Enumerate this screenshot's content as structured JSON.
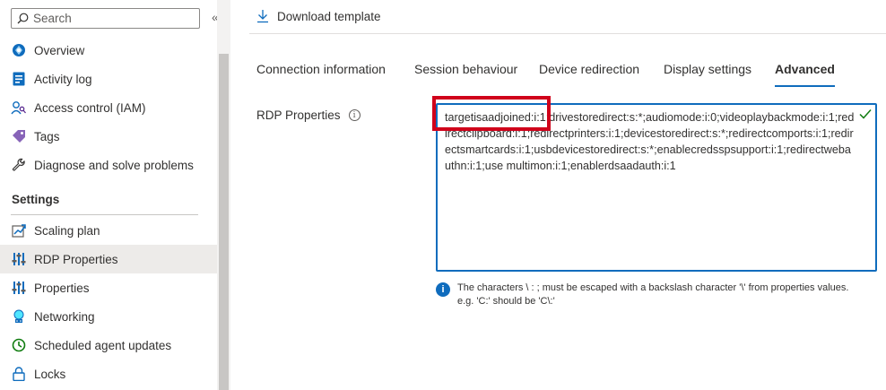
{
  "sidebar": {
    "search_placeholder": "Search",
    "collapse_glyph": "«",
    "items": [
      {
        "label": "Overview",
        "icon": "overview-icon"
      },
      {
        "label": "Activity log",
        "icon": "activity-log-icon"
      },
      {
        "label": "Access control (IAM)",
        "icon": "access-control-icon"
      },
      {
        "label": "Tags",
        "icon": "tag-icon"
      },
      {
        "label": "Diagnose and solve problems",
        "icon": "wrench-icon"
      }
    ],
    "settings_title": "Settings",
    "settings_items": [
      {
        "label": "Scaling plan",
        "icon": "scaling-plan-icon"
      },
      {
        "label": "RDP Properties",
        "icon": "rdp-properties-icon",
        "selected": true
      },
      {
        "label": "Properties",
        "icon": "properties-icon"
      },
      {
        "label": "Networking",
        "icon": "networking-icon"
      },
      {
        "label": "Scheduled agent updates",
        "icon": "scheduled-updates-icon"
      },
      {
        "label": "Locks",
        "icon": "lock-icon"
      }
    ]
  },
  "toolbar": {
    "download_label": "Download template"
  },
  "tabs": [
    {
      "label": "Connection information"
    },
    {
      "label": "Session behaviour"
    },
    {
      "label": "Device redirection"
    },
    {
      "label": "Display settings"
    },
    {
      "label": "Advanced",
      "selected": true
    }
  ],
  "rdp": {
    "label": "RDP Properties",
    "value": "targetisaadjoined:i:1;drivestoredirect:s:*;audiomode:i:0;videoplaybackmode:i:1;redirectclipboard:i:1;redirectprinters:i:1;devicestoredirect:s:*;redirectcomports:i:1;redirectsmartcards:i:1;usbdevicestoredirect:s:*;enablecredsspsupport:i:1;redirectwebauthn:i:1;use multimon:i:1;enablerdsaadauth:i:1",
    "info_text": "The characters \\ : ; must be escaped with a backslash character '\\' from properties values. e.g. 'C:' should be 'C\\:'"
  },
  "colors": {
    "accent": "#0f6cbd",
    "highlight": "#d0021b",
    "success": "#107c10"
  }
}
